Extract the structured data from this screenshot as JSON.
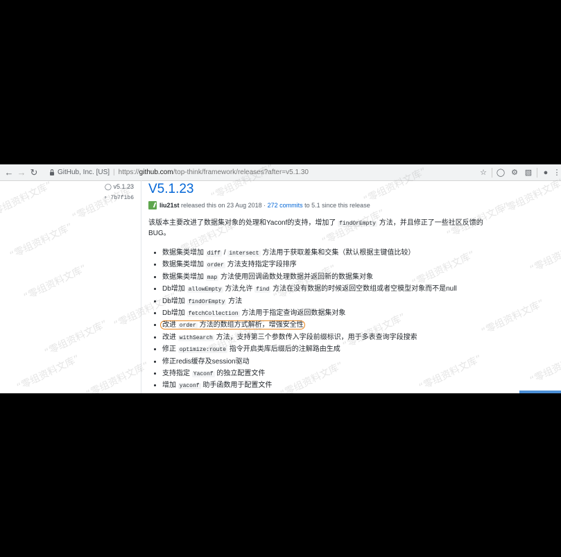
{
  "browser": {
    "site_identity": "GitHub, Inc. [US]",
    "separator": "|",
    "url_scheme": "https://",
    "url_host": "github.com",
    "url_path": "/top-think/framework/releases?after=v5.1.30",
    "back_icon": "arrow-left-icon",
    "forward_icon": "arrow-right-icon",
    "reload_icon": "reload-icon",
    "toolbar_icons": [
      "star-icon",
      "circle-extension-icon",
      "gear-extension-icon",
      "download-extension-icon",
      "account-icon",
      "menu-icon"
    ]
  },
  "sidebar": {
    "tag": "v5.1.23",
    "commit": "7b7f1b6"
  },
  "release": {
    "title": "V5.1.23",
    "author": "liu21st",
    "released_text": " released this on 23 Aug 2018 · ",
    "commits_link": "272 commits",
    "commits_suffix": " to 5.1 since this release",
    "desc_before": "该版本主要改进了数据集对象的处理和Yaconf的支持，增加了 ",
    "desc_code": "findOrEmpty",
    "desc_after": " 方法，并且修正了一些社区反馈的BUG。",
    "items": [
      {
        "pre": "数据集类增加 ",
        "c1": "diff",
        "mid": " / ",
        "c2": "intersect",
        "post": " 方法用于获取差集和交集（默认根据主键值比较）"
      },
      {
        "pre": "数据集类增加 ",
        "c1": "order",
        "post": " 方法支持指定字段排序"
      },
      {
        "pre": "数据集类增加 ",
        "c1": "map",
        "post": " 方法使用回调函数处理数据并返回新的数据集对象"
      },
      {
        "pre": "Db增加 ",
        "c1": "allowEmpty",
        "mid": " 方法允许 ",
        "c2": "find",
        "post": " 方法在没有数据的时候返回空数组或者空模型对象而不是null"
      },
      {
        "pre": "Db增加 ",
        "c1": "findOrEmpty",
        "post": " 方法"
      },
      {
        "pre": "Db增加 ",
        "c1": "fetchCollection",
        "post": " 方法用于指定查询返回数据集对象"
      },
      {
        "pre": "改进 ",
        "c1": "order",
        "post": " 方法的数组方式解析，增强安全性"
      },
      {
        "pre": "改进 ",
        "c1": "withSearch",
        "post": " 方法，支持第三个参数传入字段前缀标识，用于多表查询字段搜索"
      },
      {
        "pre": "修正 ",
        "c1": "optimize:route",
        "post": " 指令开启类库后缀后的注解路由生成"
      },
      {
        "pre": "修正redis缓存及session驱动"
      },
      {
        "pre": "支持指定 ",
        "c1": "Yaconf",
        "post": " 的独立配置文件"
      },
      {
        "pre": "增加 ",
        "c1": "yaconf",
        "post": " 助手函数用于配置文件"
      }
    ]
  },
  "watermark": "零组资料文库",
  "colors": {
    "link": "#0366d6",
    "highlight": "#e8841a",
    "avatar": "#5ea64d"
  }
}
